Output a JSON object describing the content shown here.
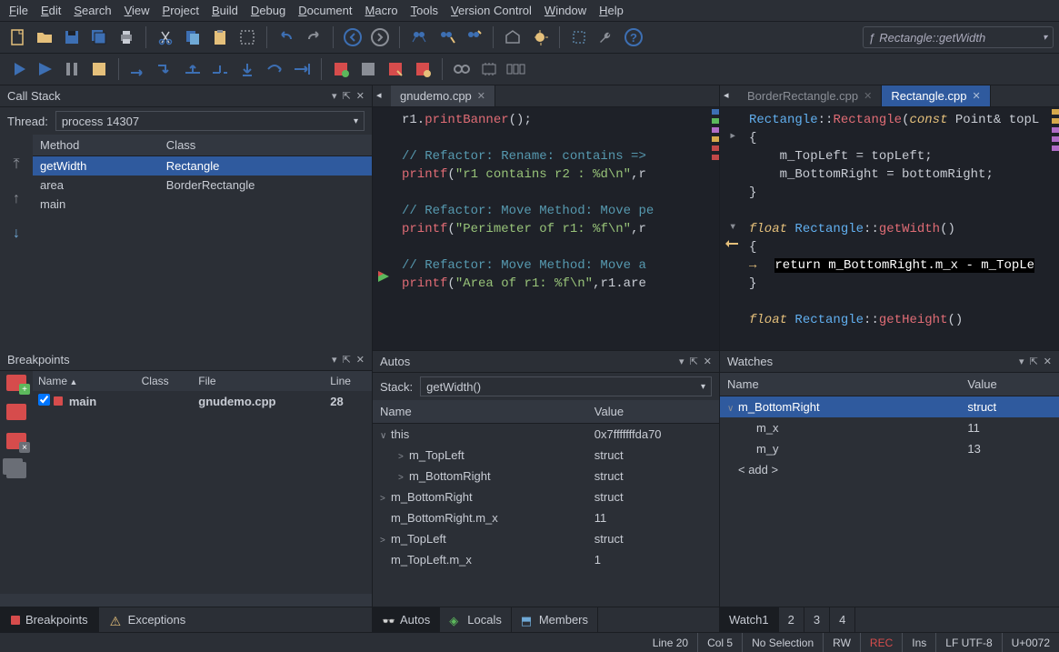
{
  "menubar": [
    "File",
    "Edit",
    "Search",
    "View",
    "Project",
    "Build",
    "Debug",
    "Document",
    "Macro",
    "Tools",
    "Version Control",
    "Window",
    "Help"
  ],
  "symbol_combo": "Rectangle::getWidth",
  "callstack": {
    "title": "Call Stack",
    "thread_label": "Thread:",
    "thread_value": "process 14307",
    "columns": [
      "Method",
      "Class"
    ],
    "rows": [
      {
        "method": "getWidth",
        "class": "Rectangle",
        "selected": true
      },
      {
        "method": "area",
        "class": "BorderRectangle"
      },
      {
        "method": "main",
        "class": ""
      }
    ]
  },
  "breakpoints": {
    "title": "Breakpoints",
    "columns": [
      "Name",
      "Class",
      "File",
      "Line"
    ],
    "rows": [
      {
        "name": "main",
        "class": "",
        "file": "gnudemo.cpp",
        "line": "28"
      }
    ],
    "tabs": [
      "Breakpoints",
      "Exceptions"
    ]
  },
  "editor1": {
    "tab": "gnudemo.cpp",
    "code_html": "r1.<span class='tfn'>printBanner</span>();\n\n<span class='tcom'>// Refactor: Rename: contains =></span>\n<span class='tfn'>printf</span>(<span class='tstr'>\"r1 contains r2 : %d\\n\"</span>,r\n\n<span class='tcom'>// Refactor: Move Method: Move pe</span>\n<span class='tfn'>printf</span>(<span class='tstr'>\"Perimeter of r1: %f\\n\"</span>,r\n\n<span class='tcom'>// Refactor: Move Method: Move a</span>\n<span class='tfn'>printf</span>(<span class='tstr'>\"Area of r1: %f\\n\"</span>,r1.are"
  },
  "editor2": {
    "tabs": [
      "BorderRectangle.cpp",
      "Rectangle.cpp"
    ],
    "active_tab": 1,
    "code_html": "<span class='ttyp'>Rectangle</span>::<span class='tfn'>Rectangle</span>(<span class='tkw'>const</span> Point& topL\n{\n    m_TopLeft = topLeft;\n    m_BottomRight = bottomRight;\n}\n\n<span class='tkw'>float</span> <span class='ttyp'>Rectangle</span>::<span class='tfn'>getWidth</span>()\n{\n<span class='yellow-arrow'>→</span> <span class='thl'>return m_BottomRight.m_x - m_TopLe</span>\n}\n\n<span class='tkw'>float</span> <span class='ttyp'>Rectangle</span>::<span class='tfn'>getHeight</span>()"
  },
  "autos": {
    "title": "Autos",
    "stack_label": "Stack:",
    "stack_value": "getWidth()",
    "columns": [
      "Name",
      "Value"
    ],
    "rows": [
      {
        "indent": 0,
        "exp": "∨",
        "name": "this",
        "value": "0x7fffffffda70"
      },
      {
        "indent": 1,
        "exp": ">",
        "name": "m_TopLeft",
        "value": "struct"
      },
      {
        "indent": 1,
        "exp": ">",
        "name": "m_BottomRight",
        "value": "struct"
      },
      {
        "indent": 0,
        "exp": ">",
        "name": "m_BottomRight",
        "value": "struct"
      },
      {
        "indent": 0,
        "exp": "",
        "name": "m_BottomRight.m_x",
        "value": "11"
      },
      {
        "indent": 0,
        "exp": ">",
        "name": "m_TopLeft",
        "value": "struct"
      },
      {
        "indent": 0,
        "exp": "",
        "name": "m_TopLeft.m_x",
        "value": "1"
      }
    ],
    "tabs": [
      "Autos",
      "Locals",
      "Members"
    ]
  },
  "watches": {
    "title": "Watches",
    "columns": [
      "Name",
      "Value"
    ],
    "rows": [
      {
        "indent": 0,
        "exp": "∨",
        "name": "m_BottomRight",
        "value": "struct",
        "selected": true
      },
      {
        "indent": 1,
        "exp": "",
        "name": "m_x",
        "value": "11"
      },
      {
        "indent": 1,
        "exp": "",
        "name": "m_y",
        "value": "13"
      },
      {
        "indent": 0,
        "exp": "",
        "name": "< add >",
        "value": ""
      }
    ],
    "tabs": [
      "Watch1",
      "2",
      "3",
      "4"
    ]
  },
  "statusbar": {
    "line": "Line 20",
    "col": "Col 5",
    "sel": "No Selection",
    "rw": "RW",
    "rec": "REC",
    "ins": "Ins",
    "enc": "LF UTF-8",
    "char": "U+0072"
  }
}
